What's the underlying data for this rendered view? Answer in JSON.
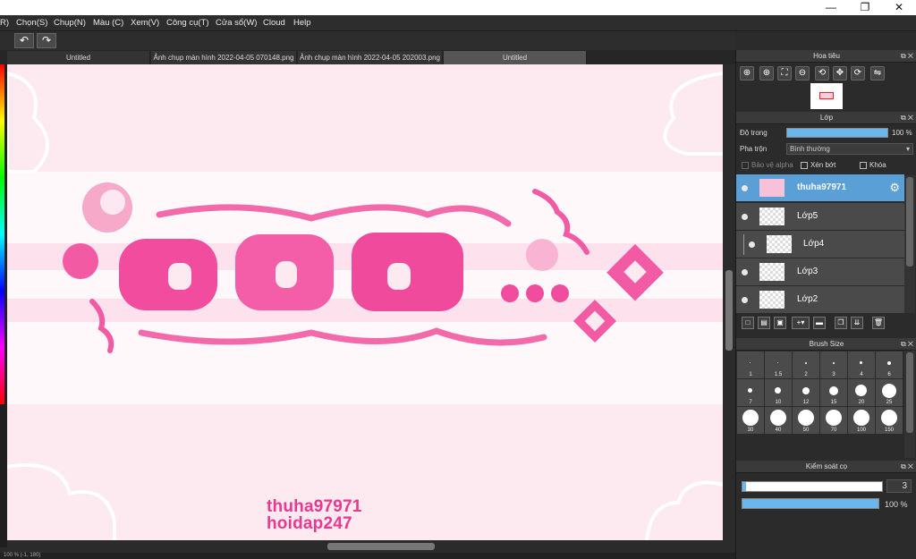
{
  "window": {
    "minimize": "—",
    "restore": "❐",
    "close": "✕"
  },
  "menu": {
    "items": [
      "R)",
      "Chọn(S)",
      "Chụp(N)",
      "Màu (C)",
      "Xem(V)",
      "Công cụ(T)",
      "Cửa sổ(W)",
      "Cloud",
      "Help"
    ]
  },
  "toolbar": {
    "undo_icon": "↶",
    "redo_icon": "↷"
  },
  "tabs": [
    "Untitled",
    "Ảnh chụp màn hình 2022-04-05 070148.png",
    "Ảnh chụp màn hình 2022-04-05 202003.png",
    "Untitled"
  ],
  "canvas": {
    "watermark_line1": "thuha97971",
    "watermark_line2": "hoidap247",
    "art_color": "#f05aa5"
  },
  "status": {
    "text": "100 %   (-1, 180)"
  },
  "navigator": {
    "title": "Hoa tiêu",
    "buttons": [
      "zoom-in",
      "zoom-in-alt",
      "fit",
      "zoom-out",
      "rotate-left",
      "fit-window",
      "rotate-right",
      "flip"
    ]
  },
  "layers": {
    "title": "Lớp",
    "opacity_label": "Độ trong",
    "opacity_value": "100 %",
    "opacity_level": 1.0,
    "blend_label": "Pha trộn",
    "blend_value": "Bình thường",
    "protect_alpha": "Bảo vệ alpha",
    "clipping": "Xén bớt",
    "lock": "Khóa",
    "items": [
      {
        "name": "thuha97971",
        "selected": true
      },
      {
        "name": "Lớp5",
        "selected": false
      },
      {
        "name": "Lớp4",
        "selected": false
      },
      {
        "name": "Lớp3",
        "selected": false
      },
      {
        "name": "Lớp2",
        "selected": false
      }
    ]
  },
  "brush_size": {
    "title": "Brush Size",
    "sizes": [
      "1",
      "1.5",
      "2",
      "3",
      "4",
      "6",
      "7",
      "10",
      "12",
      "15",
      "20",
      "25",
      "30",
      "40",
      "50",
      "70",
      "100",
      "150"
    ]
  },
  "brush_control": {
    "title": "Kiểm soát cọ",
    "size_value": "3",
    "opacity_value": "100 %",
    "opacity_level": 1.0
  }
}
